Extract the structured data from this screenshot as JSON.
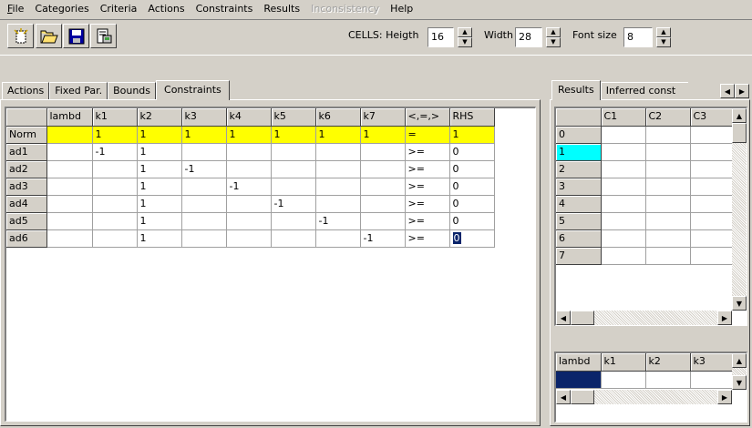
{
  "menu": [
    {
      "label": "File",
      "enabled": true
    },
    {
      "label": "Categories",
      "enabled": true
    },
    {
      "label": "Criteria",
      "enabled": true
    },
    {
      "label": "Actions",
      "enabled": true
    },
    {
      "label": "Constraints",
      "enabled": true
    },
    {
      "label": "Results",
      "enabled": true
    },
    {
      "label": "Inconsistency",
      "enabled": false
    },
    {
      "label": "Help",
      "enabled": true
    }
  ],
  "toolbar": {
    "new_icon": "new-file-icon",
    "open_icon": "open-folder-icon",
    "save_icon": "save-disk-icon",
    "print_icon": "print-preview-icon",
    "cells_label": "CELLS: Heigth",
    "height_value": "16",
    "width_label": "Width",
    "width_value": "28",
    "font_label": "Font size",
    "font_value": "8"
  },
  "left_tabs": [
    "Actions",
    "Fixed Par.",
    "Bounds",
    "Constraints"
  ],
  "left_active_tab": "Constraints",
  "constraints_grid": {
    "headers": [
      "",
      "lambd",
      "k1",
      "k2",
      "k3",
      "k4",
      "k5",
      "k6",
      "k7",
      "<,=,>",
      "RHS"
    ],
    "rows": [
      [
        "Norm",
        "",
        "1",
        "1",
        "1",
        "1",
        "1",
        "1",
        "1",
        "=",
        "1"
      ],
      [
        "ad1",
        "",
        "-1",
        "1",
        "",
        "",
        "",
        "",
        "",
        ">=",
        "0"
      ],
      [
        "ad2",
        "",
        "",
        "1",
        "-1",
        "",
        "",
        "",
        "",
        ">=",
        "0"
      ],
      [
        "ad3",
        "",
        "",
        "1",
        "",
        "-1",
        "",
        "",
        "",
        ">=",
        "0"
      ],
      [
        "ad4",
        "",
        "",
        "1",
        "",
        "",
        "-1",
        "",
        "",
        ">=",
        "0"
      ],
      [
        "ad5",
        "",
        "",
        "1",
        "",
        "",
        "",
        "-1",
        "",
        ">=",
        "0"
      ],
      [
        "ad6",
        "",
        "",
        "1",
        "",
        "",
        "",
        "",
        "-1",
        ">=",
        "0"
      ]
    ]
  },
  "right_tabs": [
    "Results",
    "Inferred const"
  ],
  "right_active_tab": "Results",
  "results_grid": {
    "headers": [
      "",
      "C1",
      "C2",
      "C3"
    ],
    "rows": [
      "0",
      "1",
      "2",
      "3",
      "4",
      "5",
      "6",
      "7"
    ]
  },
  "inferred_grid": {
    "headers": [
      "lambd",
      "k1",
      "k2",
      "k3"
    ]
  },
  "colors": {
    "window_bg": "#d4d0c8",
    "norm_row": "#ffff00",
    "selected_row_header": "#00ffff",
    "selection": "#0a246a"
  }
}
